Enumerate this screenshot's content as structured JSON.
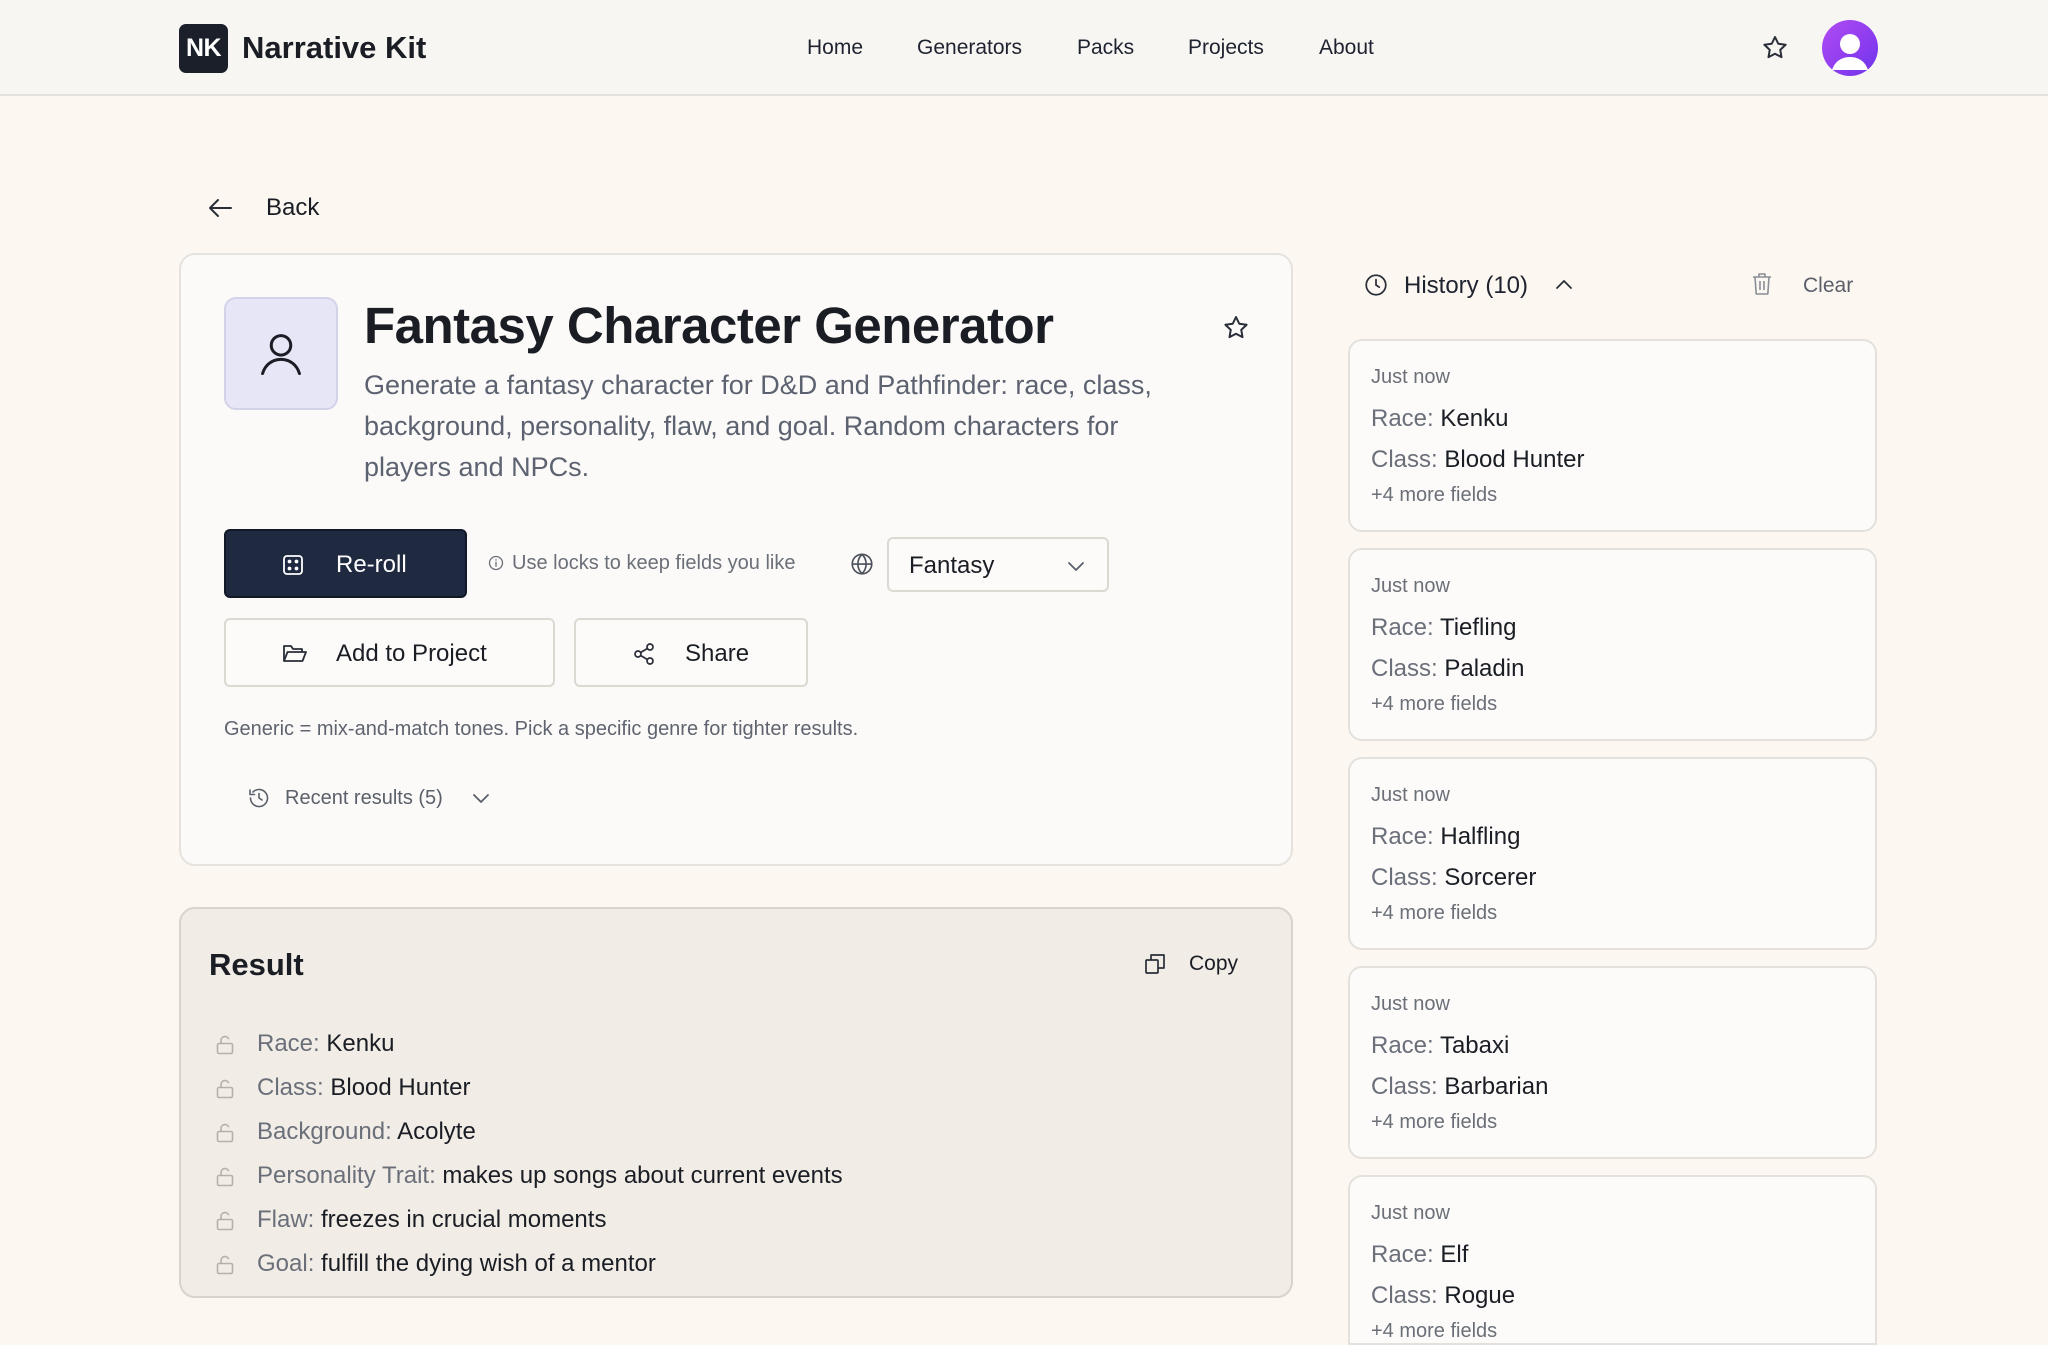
{
  "brand": {
    "logo": "NK",
    "name": "Narrative Kit"
  },
  "nav": [
    {
      "label": "Home"
    },
    {
      "label": "Generators"
    },
    {
      "label": "Packs"
    },
    {
      "label": "Projects"
    },
    {
      "label": "About"
    }
  ],
  "nav_icons": {
    "favorites": "star-icon",
    "profile": "avatar"
  },
  "back": {
    "label": "Back",
    "icon": "arrow-left-icon"
  },
  "generator": {
    "title": "Fantasy Character Generator",
    "description": "Generate a fantasy character for D&D and Pathfinder: race, class, background, personality, flaw, and goal. Random characters for players and NPCs.",
    "icon": "user-icon"
  },
  "actions": {
    "reroll_label": "Re-roll",
    "locks_hint": "Use locks to keep fields you like",
    "genre_selected": "Fantasy",
    "add_project_label": "Add to Project",
    "share_label": "Share",
    "generic_note": "Generic = mix-and-match tones. Pick a specific genre for tighter results.",
    "recent_label": "Recent results (5)"
  },
  "result": {
    "title": "Result",
    "copy_label": "Copy",
    "fields": [
      {
        "key": "Race:",
        "value": "Kenku"
      },
      {
        "key": "Class:",
        "value": "Blood Hunter"
      },
      {
        "key": "Background:",
        "value": "Acolyte"
      },
      {
        "key": "Personality Trait:",
        "value": "makes up songs about current events"
      },
      {
        "key": "Flaw:",
        "value": "freezes in crucial moments"
      },
      {
        "key": "Goal:",
        "value": "fulfill the dying wish of a mentor"
      }
    ]
  },
  "history": {
    "label": "History (10)",
    "clear_label": "Clear",
    "items": [
      {
        "time": "Just now",
        "race_key": "Race:",
        "race": "Kenku",
        "class_key": "Class:",
        "class": "Blood Hunter",
        "more": "+4 more fields"
      },
      {
        "time": "Just now",
        "race_key": "Race:",
        "race": "Tiefling",
        "class_key": "Class:",
        "class": "Paladin",
        "more": "+4 more fields"
      },
      {
        "time": "Just now",
        "race_key": "Race:",
        "race": "Halfling",
        "class_key": "Class:",
        "class": "Sorcerer",
        "more": "+4 more fields"
      },
      {
        "time": "Just now",
        "race_key": "Race:",
        "race": "Tabaxi",
        "class_key": "Class:",
        "class": "Barbarian",
        "more": "+4 more fields"
      },
      {
        "time": "Just now",
        "race_key": "Race:",
        "race": "Elf",
        "class_key": "Class:",
        "class": "Rogue",
        "more": "+4 more fields"
      }
    ]
  },
  "colors": {
    "background": "#fcf8f1",
    "primary_button": "#1f2940",
    "avatar_gradient_start": "#b14cf2",
    "avatar_gradient_end": "#6d35e8",
    "icon_tile": "#e7e6f6"
  }
}
